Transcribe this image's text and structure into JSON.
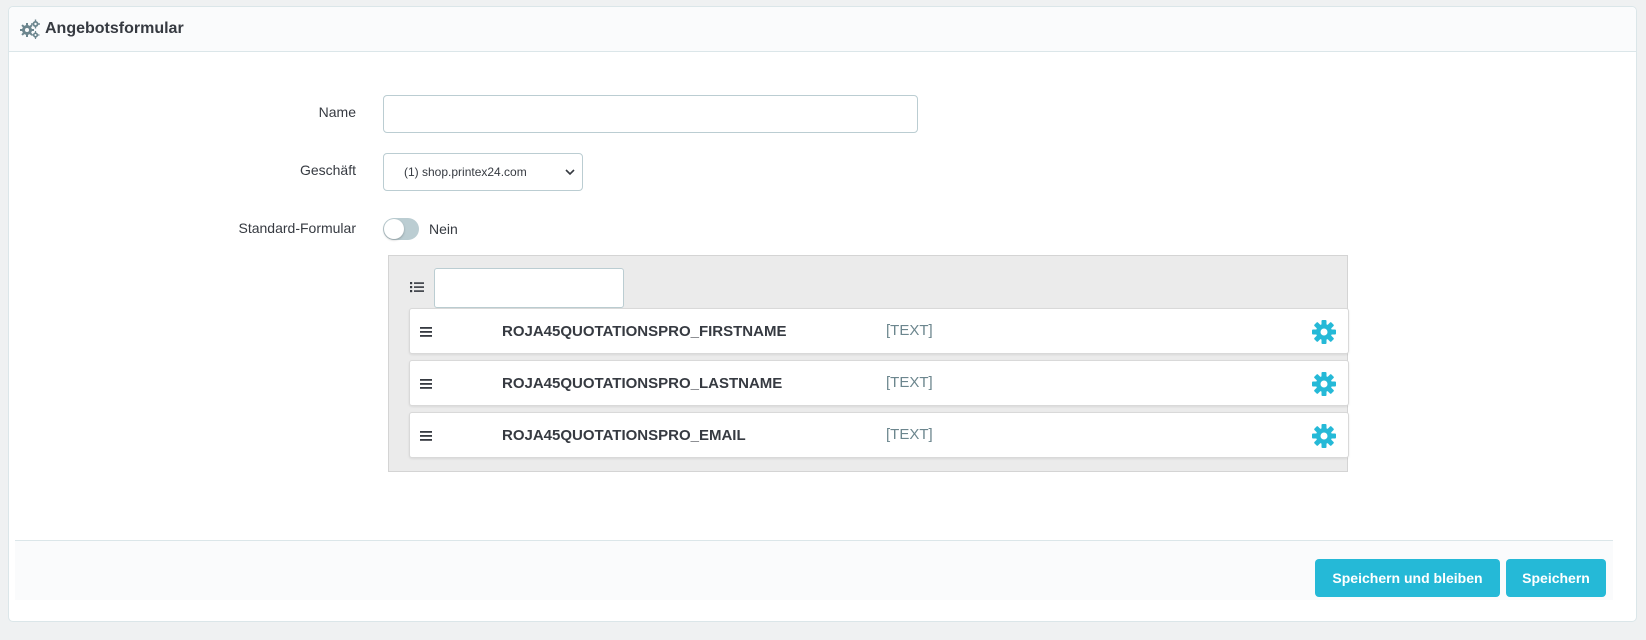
{
  "panel": {
    "title": "Angebotsformular",
    "title_icon": "gears-icon"
  },
  "form": {
    "name_label": "Name",
    "name_value": "",
    "shop_label": "Geschäft",
    "shop_selected": "(1) shop.printex24.com",
    "default_label": "Standard-Formular",
    "default_toggle_text": "Nein",
    "default_toggle_on": false
  },
  "fields": {
    "filter_value": "",
    "list_icon": "list-icon",
    "items": [
      {
        "name": "ROJA45QUOTATIONSPRO_FIRSTNAME",
        "type": "[TEXT]"
      },
      {
        "name": "ROJA45QUOTATIONSPRO_LASTNAME",
        "type": "[TEXT]"
      },
      {
        "name": "ROJA45QUOTATIONSPRO_EMAIL",
        "type": "[TEXT]"
      }
    ]
  },
  "footer": {
    "save_stay_label": "Speichern und bleiben",
    "save_label": "Speichern"
  },
  "colors": {
    "accent": "#25b9d7",
    "text": "#363a41",
    "border": "#bbcdd2"
  }
}
